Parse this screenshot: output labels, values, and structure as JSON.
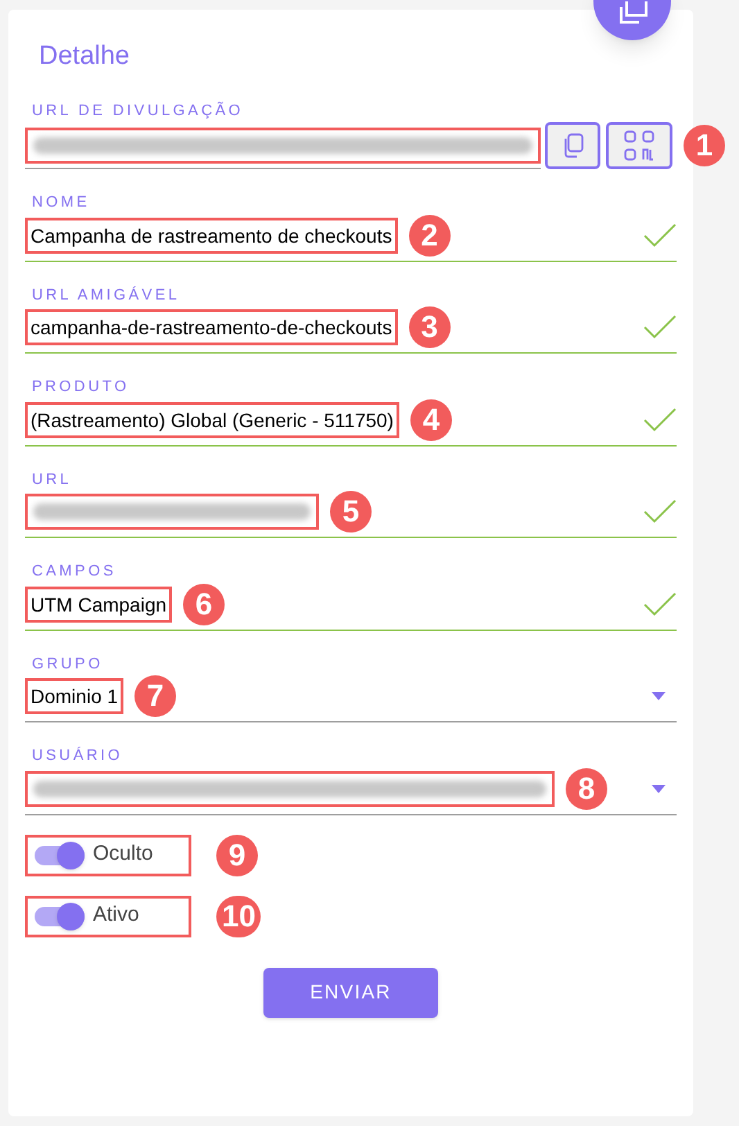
{
  "title": "Detalhe",
  "fields": [
    {
      "kind": "url",
      "label": "URL DE DIVULGAÇÃO",
      "redacted": true,
      "valid": false,
      "marker": "1"
    },
    {
      "kind": "text",
      "label": "NOME",
      "value": "Campanha de rastreamento de checkouts",
      "valid": true,
      "marker": "2"
    },
    {
      "kind": "text",
      "label": "URL AMIGÁVEL",
      "value": "campanha-de-rastreamento-de-checkouts",
      "valid": true,
      "marker": "3"
    },
    {
      "kind": "text",
      "label": "PRODUTO",
      "value": "(Rastreamento) Global (Generic - 511750)",
      "valid": true,
      "marker": "4"
    },
    {
      "kind": "text",
      "label": "URL",
      "redacted": true,
      "valid": true,
      "marker": "5"
    },
    {
      "kind": "text",
      "label": "CAMPOS",
      "value": "UTM Campaign",
      "valid": true,
      "marker": "6"
    },
    {
      "kind": "select",
      "label": "GRUPO",
      "value": "Dominio 1",
      "valid": false,
      "marker": "7"
    },
    {
      "kind": "select",
      "label": "USUÁRIO",
      "redacted": true,
      "valid": false,
      "marker": "8"
    }
  ],
  "toggles": [
    {
      "label": "Oculto",
      "on": true,
      "marker": "9"
    },
    {
      "label": "Ativo",
      "on": true,
      "marker": "10"
    }
  ],
  "submit": "ENVIAR"
}
